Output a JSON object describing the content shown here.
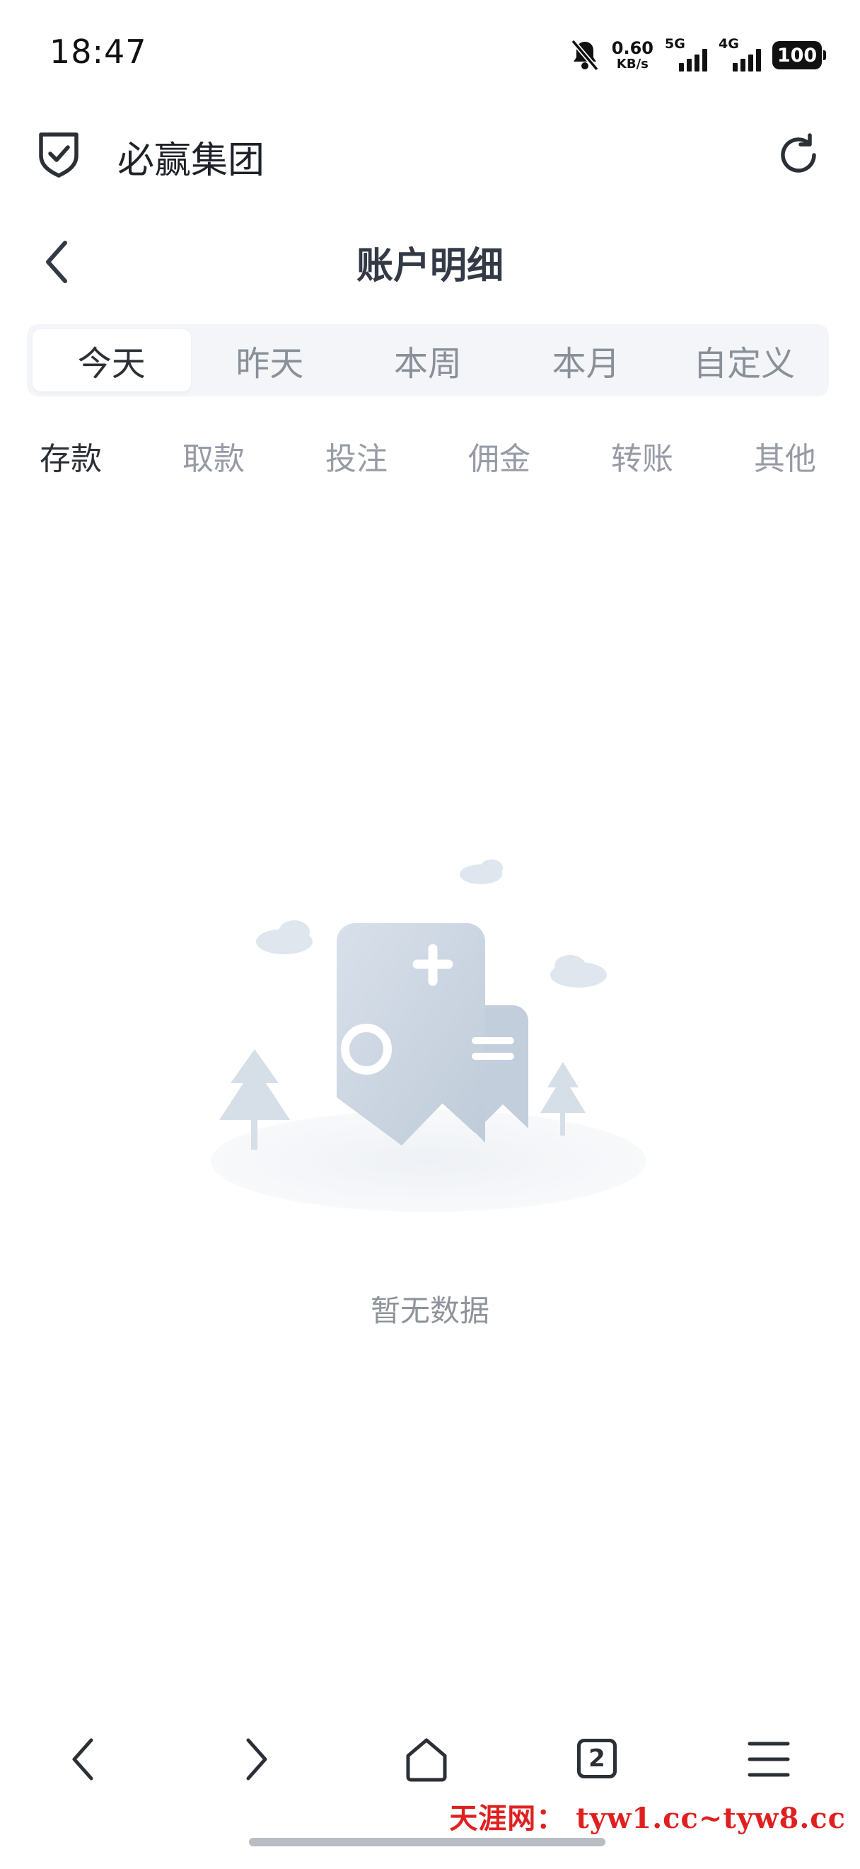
{
  "status_bar": {
    "time": "18:47",
    "net_speed_value": "0.60",
    "net_speed_unit": "KB/s",
    "signal_1_label": "5G",
    "signal_2_label": "4G",
    "battery": "100",
    "icons": [
      "bell-muted-icon",
      "signal-5g-icon",
      "signal-4g-icon",
      "battery-icon"
    ]
  },
  "app_bar": {
    "title": "必赢集团",
    "icons": [
      "shield-check-icon",
      "refresh-icon"
    ]
  },
  "page_header": {
    "title": "账户明细",
    "icons": [
      "back-chevron-icon"
    ]
  },
  "date_tabs": {
    "active": "今天",
    "items": [
      {
        "label": "今天"
      },
      {
        "label": "昨天"
      },
      {
        "label": "本周"
      },
      {
        "label": "本月"
      },
      {
        "label": "自定义"
      }
    ]
  },
  "category_tabs": {
    "active": "存款",
    "items": [
      {
        "label": "存款"
      },
      {
        "label": "取款"
      },
      {
        "label": "投注"
      },
      {
        "label": "佣金"
      },
      {
        "label": "转账"
      },
      {
        "label": "其他"
      }
    ]
  },
  "empty_state": {
    "text": "暂无数据",
    "icon": "empty-data-illustration"
  },
  "bottom_nav": {
    "open_tabs_count": "2",
    "icons": [
      "back-icon",
      "forward-icon",
      "home-icon",
      "tabs-icon",
      "menu-icon"
    ]
  },
  "watermark": "天涯网： tyw1.cc~tyw8.cc",
  "colors": {
    "text_primary": "#2b2f36",
    "text_muted": "#969ba5",
    "tab_track": "#f3f5f8",
    "illustration": "#c6d1df",
    "watermark": "#e02020"
  }
}
